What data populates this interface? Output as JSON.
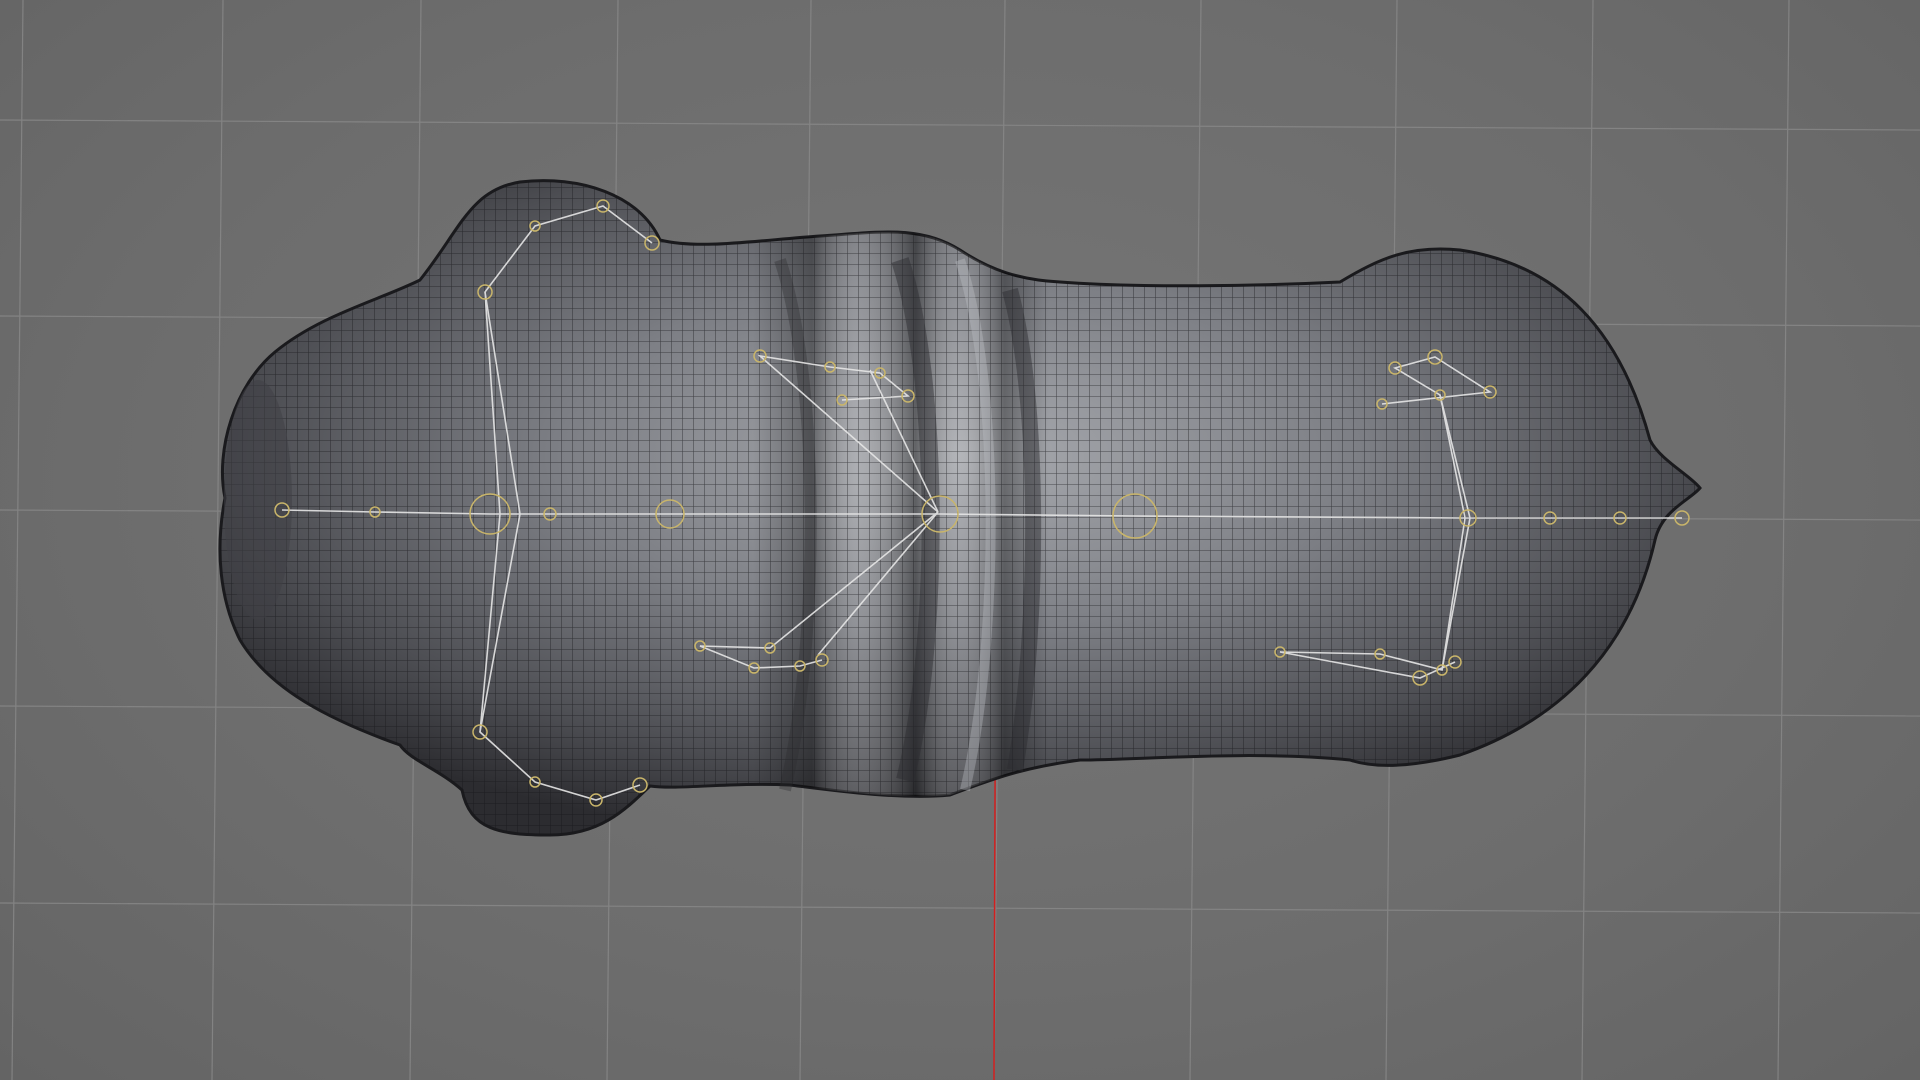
{
  "viewport": {
    "name": "3D Viewport",
    "view": "top",
    "background_color": "#6f6f6f",
    "grid_color": "#8a8a8a",
    "x_axis_color": "#d21f1f",
    "y_axis_color": "#2fa82f",
    "grid_visible": true
  },
  "model": {
    "type": "quadruped-body-mesh",
    "display": "wireframe-on-shaded",
    "surface_color": "#4a4b50",
    "wire_color": "#1c1c1e",
    "rig": {
      "bone_color": "#e6e6e6",
      "joint_color": "#c9b56a",
      "visible": true
    }
  }
}
